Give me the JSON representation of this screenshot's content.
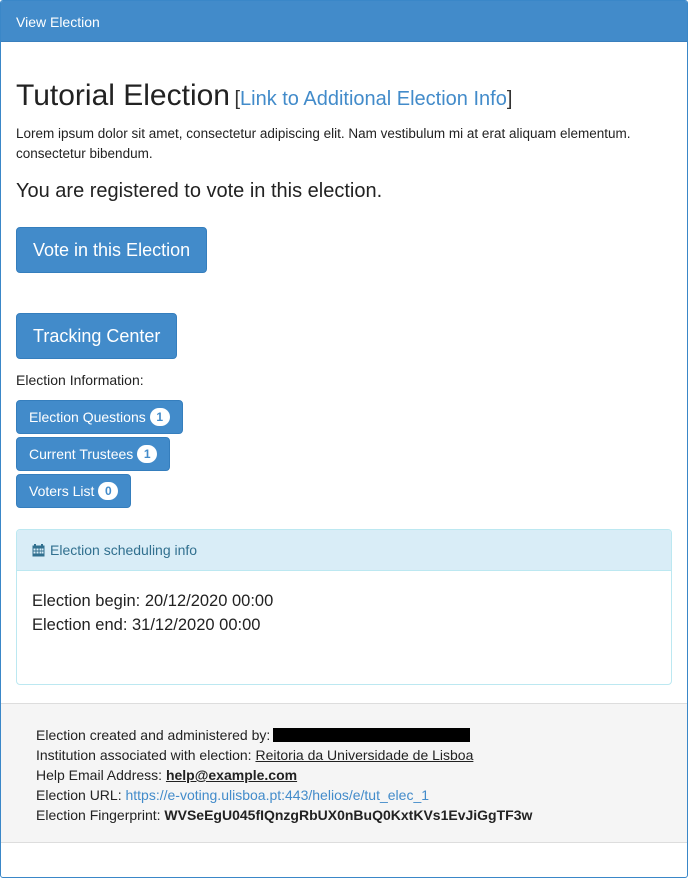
{
  "header": {
    "title": "View Election"
  },
  "election": {
    "title": "Tutorial Election",
    "link_open": "[",
    "link_text": "Link to Additional Election Info",
    "link_close": "]",
    "description": "Lorem ipsum dolor sit amet, consectetur adipiscing elit. Nam vestibulum mi at erat aliquam elementum. consectetur bibendum.",
    "registered_text": "You are registered to vote in this election."
  },
  "actions": {
    "vote_label": "Vote in this Election",
    "tracking_label": "Tracking Center"
  },
  "info": {
    "label": "Election Information:",
    "buttons": [
      {
        "label": "Election Questions",
        "count": "1"
      },
      {
        "label": "Current Trustees",
        "count": "1"
      },
      {
        "label": "Voters List",
        "count": "0"
      }
    ]
  },
  "schedule": {
    "heading": "Election scheduling info",
    "icon": "calendar-icon",
    "begin": "Election begin: 20/12/2020 00:00",
    "end": "Election end: 31/12/2020 00:00"
  },
  "footer": {
    "created_label": "Election created and administered by:",
    "institution_label": "Institution associated with election:",
    "institution_value": "Reitoria da Universidade de Lisboa",
    "help_label": "Help Email Address:",
    "help_value": "help@example.com",
    "url_label": "Election URL:",
    "url_value": "https://e-voting.ulisboa.pt:443/helios/e/tut_elec_1",
    "fingerprint_label": "Election Fingerprint:",
    "fingerprint_value": "WVSeEgU045fIQnzgRbUX0nBuQ0KxtKVs1EvJiGgTF3w"
  },
  "colors": {
    "primary": "#428bca",
    "info_bg": "#d9edf7",
    "info_text": "#31708f"
  }
}
